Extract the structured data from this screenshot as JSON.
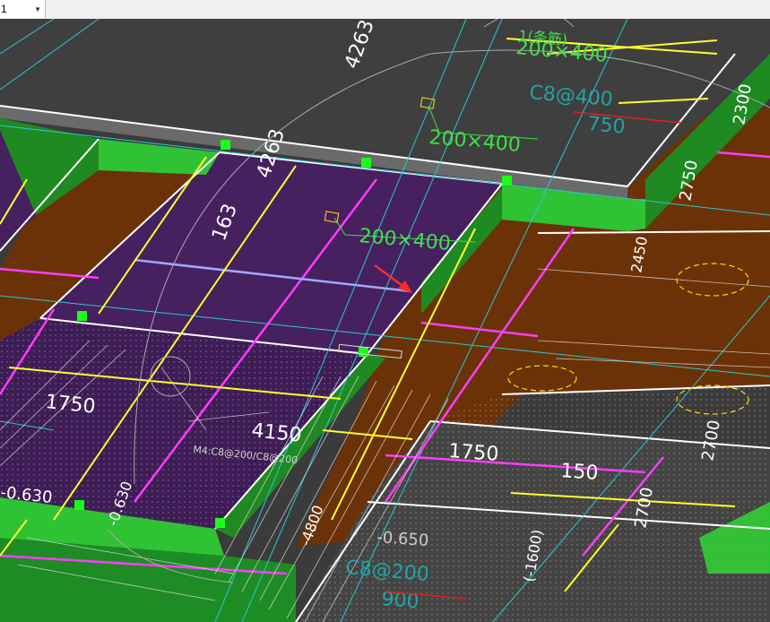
{
  "toolbar": {
    "layer_select_value": "1"
  },
  "drawing": {
    "labels": {
      "dim_4263_top": "4263",
      "beam_label_top": "1(条筋)",
      "beam_size_top": "200×400",
      "stirrup_top": "C8@400",
      "dim_750": "750",
      "beam_size_mid": "200×400",
      "dim_4263_mid": "4263",
      "dim_163": "163",
      "beam_size_center": "200×400",
      "dim_2300": "2300",
      "dim_2750": "2750",
      "dim_2450": "2450",
      "dim_1750_left": "1750",
      "dim_4150": "4150",
      "slab_rebar_note": "M4:C8@200/C8@200",
      "elev_left": "-0.630",
      "elev_mid": "-0.630",
      "dim_1750_right": "1750",
      "dim_150": "150",
      "dim_2700": "2700",
      "dim_2700_right": "2700",
      "elev_bottom": "-0.650",
      "dim_1600": "(-1600)",
      "stirrup_bottom": "C8@200",
      "dim_900": "900",
      "dim_4800": "-4800"
    }
  },
  "colors": {
    "background": "#3b3b3b",
    "slab_purple": "#46205f",
    "slab_brown": "#6b3207",
    "beam_green": "#2fc234",
    "beam_dark_green": "#1f8a22",
    "grid_cyan": "#2bc6d6",
    "rebar_magenta": "#ff3cff",
    "rebar_yellow": "#ffff2e",
    "dimension_white": "#ffffff",
    "selection_red": "#ff2a2a"
  }
}
